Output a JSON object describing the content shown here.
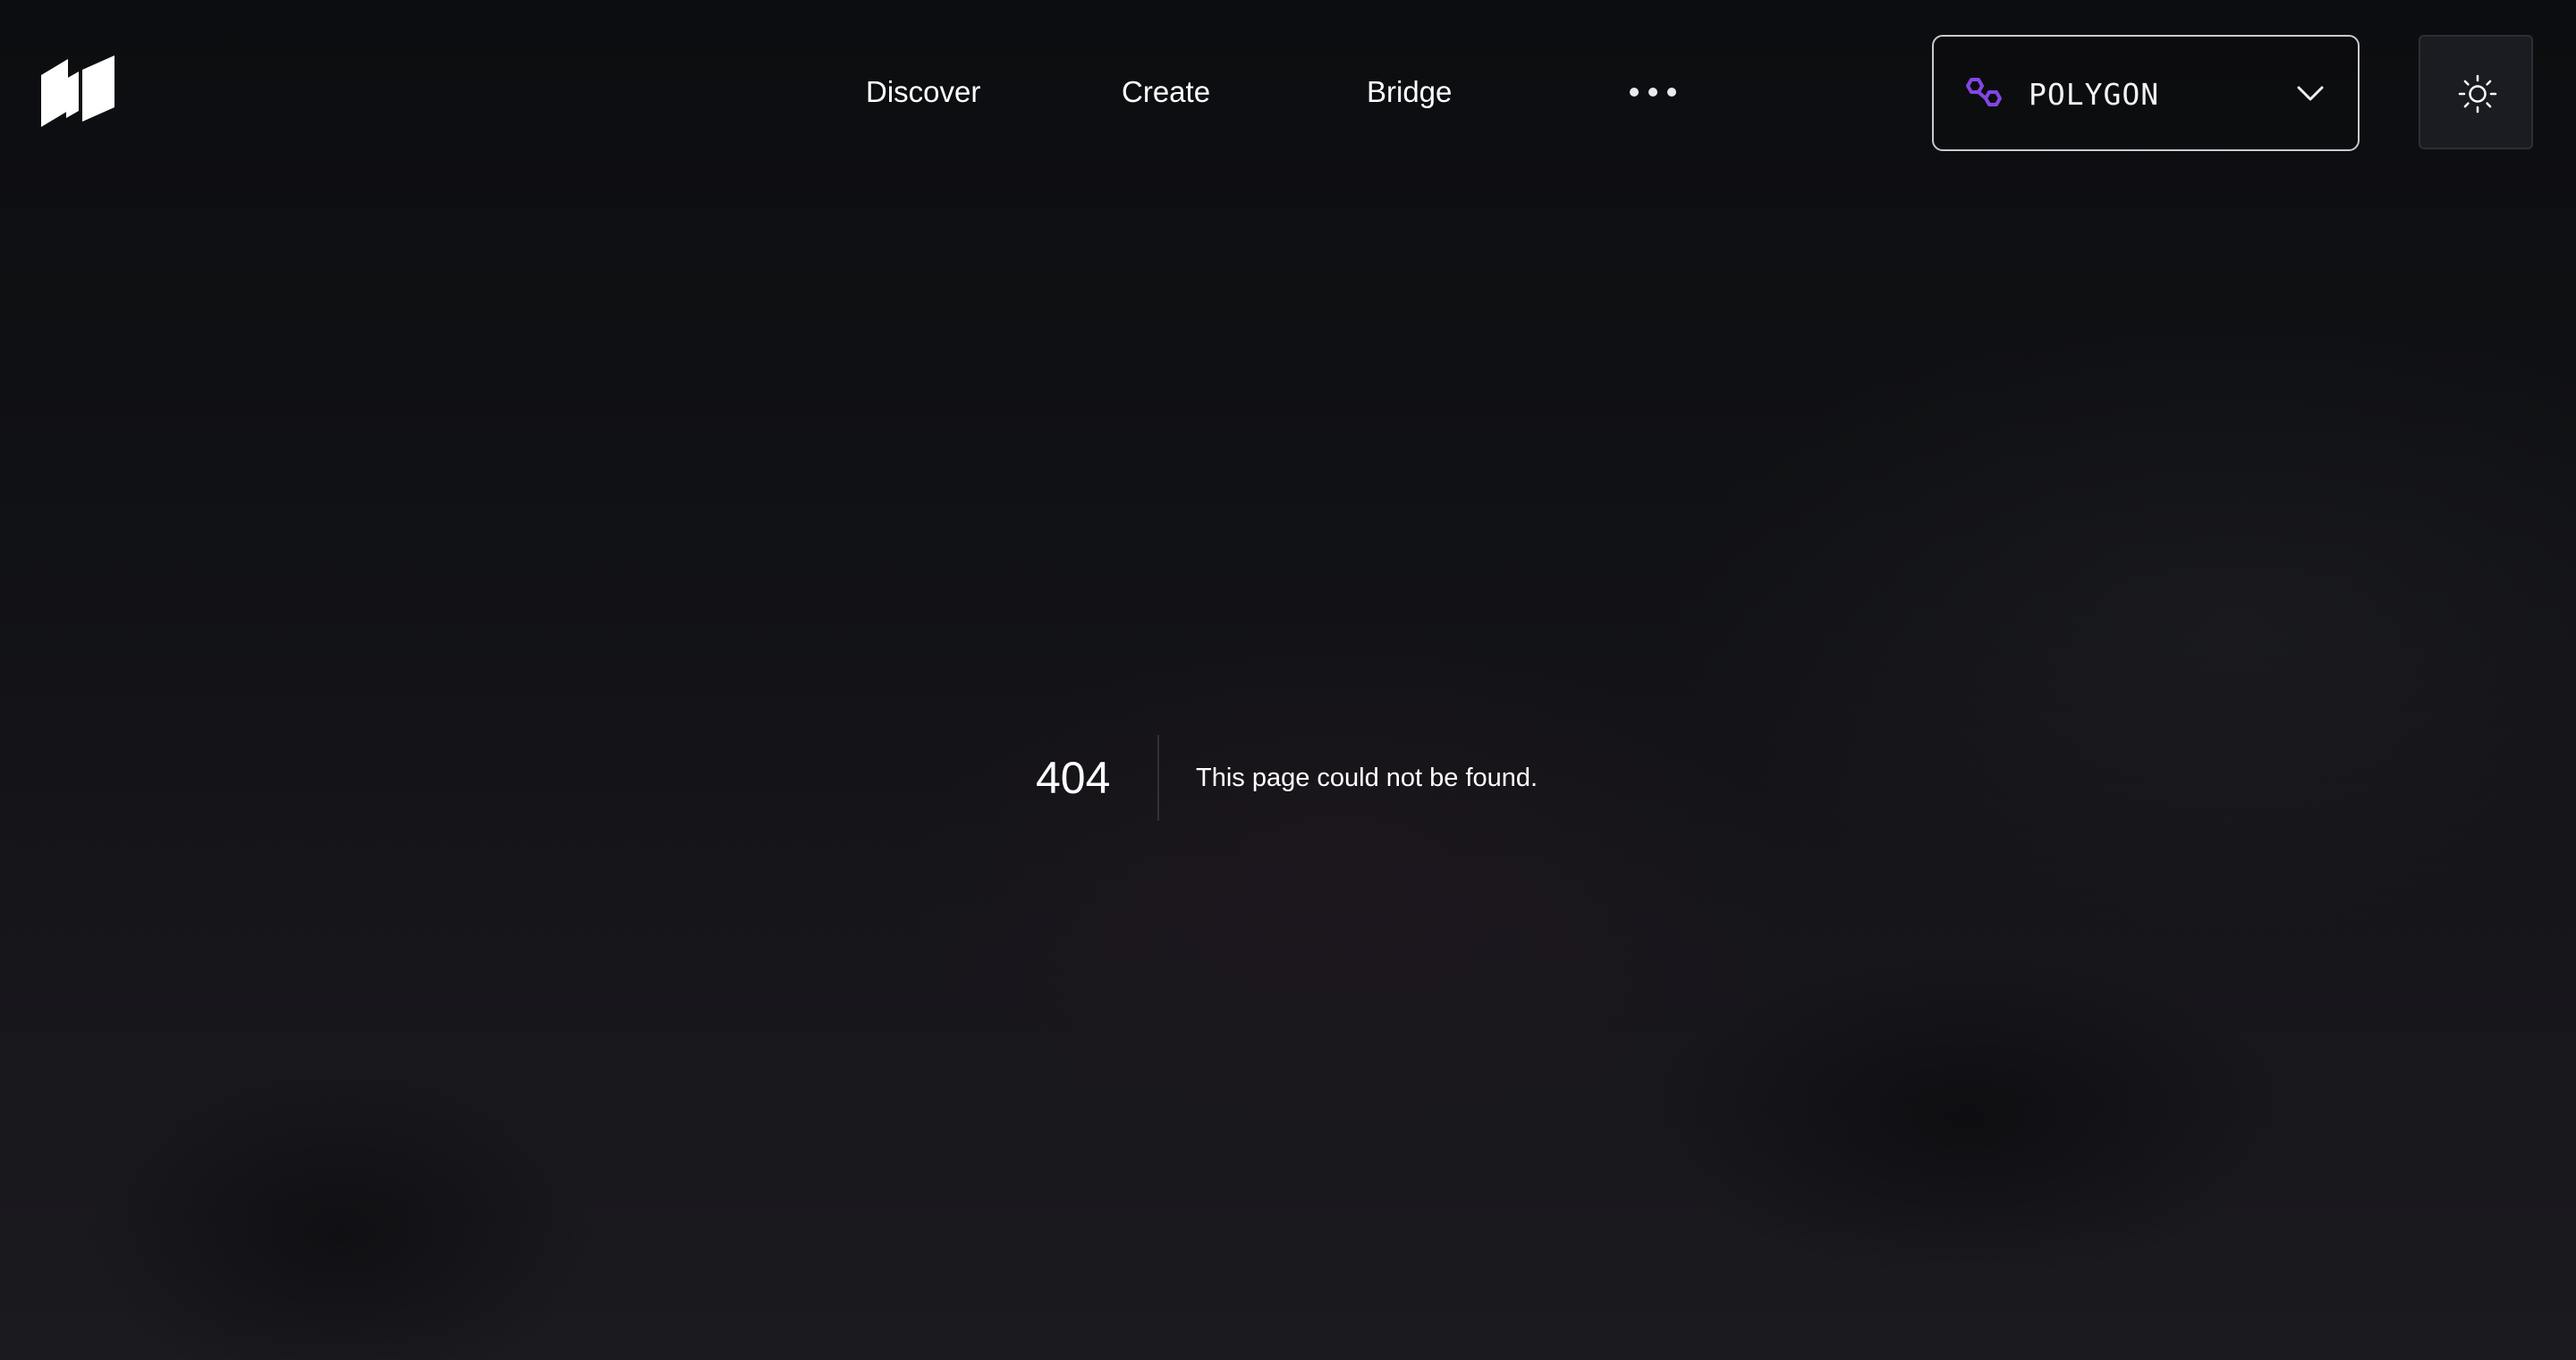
{
  "header": {
    "logo": {
      "icon": "brand-logo-icon"
    },
    "nav": {
      "items": [
        {
          "label": "Discover"
        },
        {
          "label": "Create"
        },
        {
          "label": "Bridge"
        }
      ],
      "more": {
        "icon": "more-dots-icon"
      }
    },
    "network_select": {
      "selected": "POLYGON",
      "icon": "polygon-icon",
      "chevron": "chevron-down-icon",
      "accent_color": "#8247e5"
    },
    "theme_toggle": {
      "icon": "sun-icon"
    }
  },
  "error": {
    "code": "404",
    "message": "This page could not be found."
  },
  "colors": {
    "background": "#111114",
    "text": "#ffffff",
    "select_border": "#c9c9cf",
    "toggle_background": "#1b1c21"
  }
}
